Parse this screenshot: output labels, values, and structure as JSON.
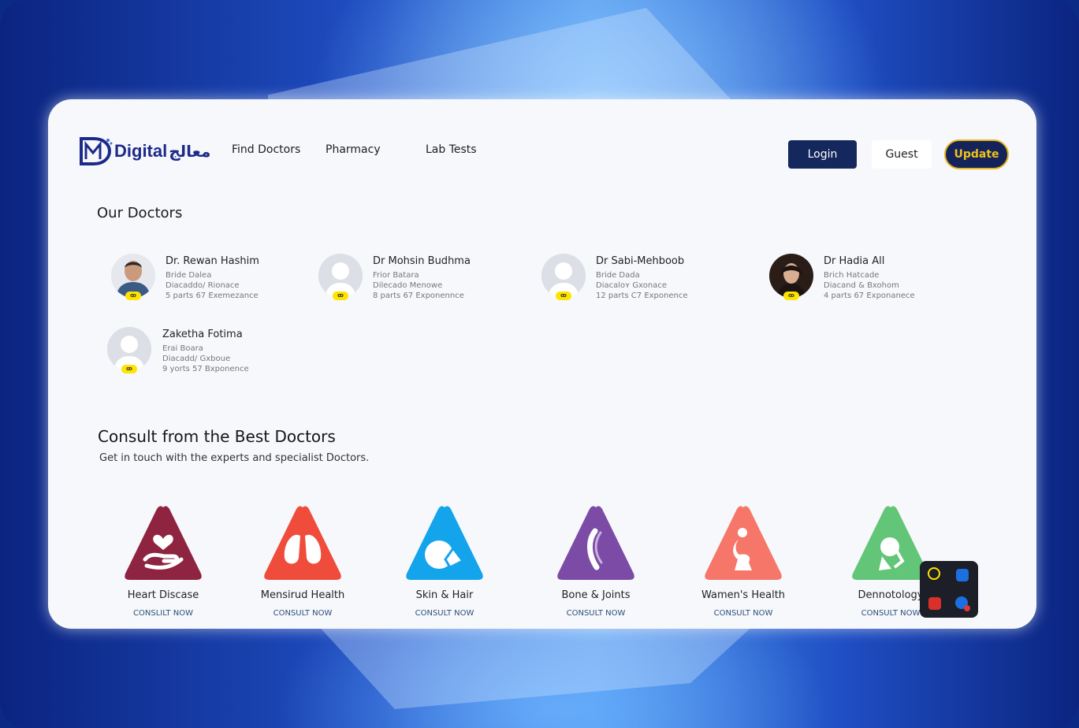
{
  "brand": {
    "latin": "Digital",
    "arabic": "معالج",
    "color": "#1c2a8a"
  },
  "nav": {
    "find_doctors": "Find Doctors",
    "pharmacy": "Pharmacy",
    "lab_tests": "Lab Tests"
  },
  "header": {
    "login": "Login",
    "guest": "Guest",
    "update": "Update"
  },
  "our_doctors": {
    "title": "Our Doctors",
    "doctors": [
      {
        "name": "Dr. Rewan Hashim",
        "line1": "Bride Dalea",
        "line2": "Diacaddo/ Rionace",
        "line3": "5 parts 67 Exemezance",
        "badge": "ꝏ",
        "photo": "male-photo"
      },
      {
        "name": "Dr Mohsin Budhma",
        "line1": "Frior Batara",
        "line2": "Dilecado Menowe",
        "line3": "8 parts 67 Exponennce",
        "badge": "ꝏ",
        "photo": "placeholder"
      },
      {
        "name": "Dr Sabi-Mehboob",
        "line1": "Bride Dada",
        "line2": "Diacaloʏ Gxonace",
        "line3": "12 parts C7 Exponence",
        "badge": "ꝏ",
        "photo": "placeholder"
      },
      {
        "name": "Dr Hadia All",
        "line1": "Brich Hatcade",
        "line2": "Diacand & Bxohom",
        "line3": "4 parts 67 Exponanece",
        "badge": "ꝏ",
        "photo": "female-photo"
      },
      {
        "name": "Zaketha Fotima",
        "line1": "Erai Boara",
        "line2": "Diacadd/ Gxboue",
        "line3": "9 yorts 57 Bxponence",
        "badge": "ꝏ",
        "photo": "placeholder"
      }
    ]
  },
  "consult": {
    "title": "Consult from the Best Doctors",
    "subtitle": "Get in touch with the experts and specialist Doctors.",
    "specialties": [
      {
        "label": "Heart Discase",
        "cta": "CONSLILT NOW",
        "color": "#8f2440",
        "icon": "heart-hand-icon"
      },
      {
        "label": "Mensirud Health",
        "cta": "CONSULT NOW",
        "color": "#ef4c3c",
        "icon": "lungs-icon"
      },
      {
        "label": "Skin & Hair",
        "cta": "CONSULT NOW",
        "color": "#13a4ec",
        "icon": "skin-hair-icon"
      },
      {
        "label": "Bone & Joints",
        "cta": "CONSULT NOW",
        "color": "#7b4ba5",
        "icon": "bone-icon"
      },
      {
        "label": "Wamen's Health",
        "cta": "CONSULT NOW",
        "color": "#f6776a",
        "icon": "pregnant-woman-icon"
      },
      {
        "label": "Dennotology",
        "cta": "CONSULT NOW",
        "color": "#62c577",
        "icon": "derma-icon"
      }
    ]
  }
}
